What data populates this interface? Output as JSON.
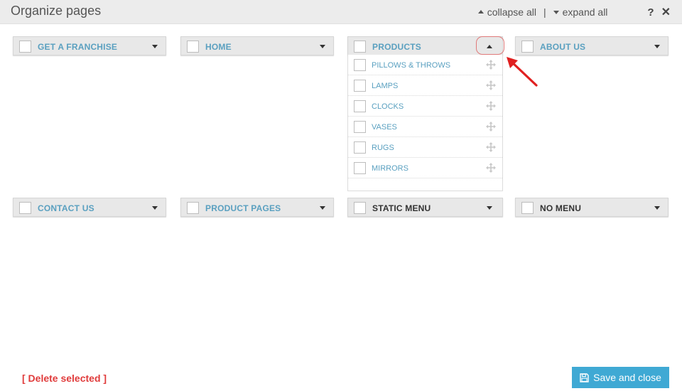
{
  "header": {
    "title": "Organize pages",
    "collapse_all": "collapse all",
    "separator": "|",
    "expand_all": "expand all",
    "help": "?",
    "close": "✕"
  },
  "menus": [
    {
      "label": "GET A FRANCHISE",
      "expanded": false
    },
    {
      "label": "HOME",
      "expanded": false
    },
    {
      "label": "PRODUCTS",
      "expanded": true
    },
    {
      "label": "ABOUT US",
      "expanded": false
    },
    {
      "label": "CONTACT US",
      "expanded": false
    },
    {
      "label": "PRODUCT PAGES",
      "expanded": false
    },
    {
      "label": "STATIC MENU",
      "expanded": false
    },
    {
      "label": "NO MENU",
      "expanded": false
    }
  ],
  "products_items": [
    {
      "label": "PILLOWS & THROWS"
    },
    {
      "label": "LAMPS"
    },
    {
      "label": "CLOCKS"
    },
    {
      "label": "VASES"
    },
    {
      "label": "RUGS"
    },
    {
      "label": "MIRRORS"
    }
  ],
  "footer": {
    "delete_selected": "[ Delete selected ]",
    "save_and_close": "Save and close"
  },
  "colors": {
    "accent": "#3fa9d4",
    "link_blue": "#5aa0c0",
    "danger": "#e03b3b",
    "annotation_red": "#e02020"
  },
  "icons": [
    "collapse-up-icon",
    "expand-down-icon",
    "help-icon",
    "close-icon",
    "caret-down-icon",
    "caret-up-icon",
    "move-icon",
    "save-icon"
  ]
}
